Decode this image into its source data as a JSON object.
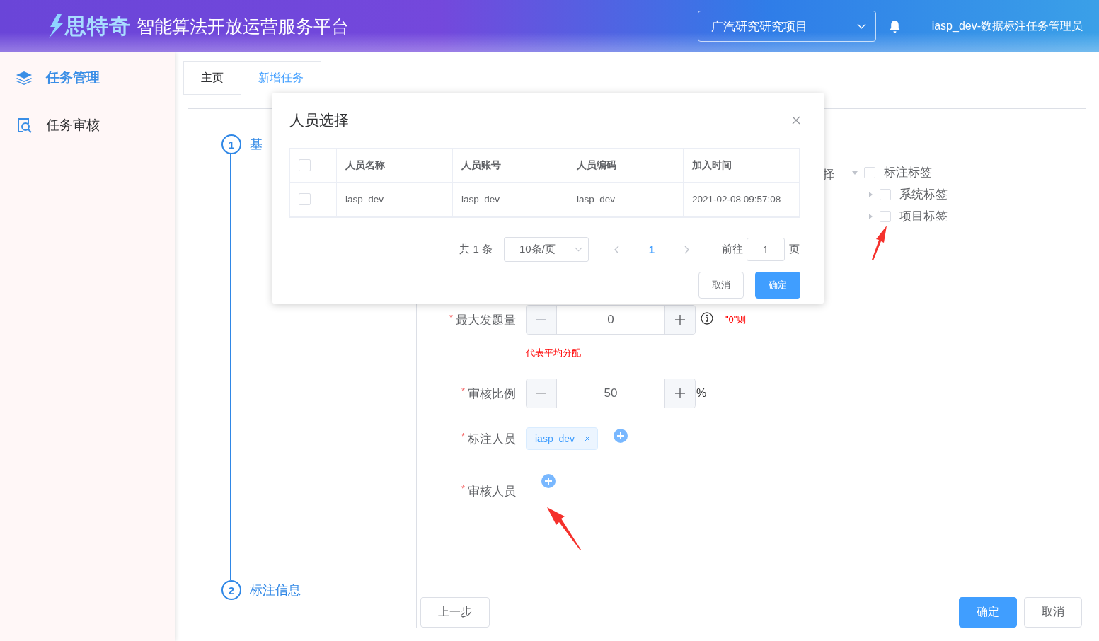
{
  "header": {
    "logo_text": "思特奇",
    "title": "智能算法开放运营服务平台",
    "project_select": {
      "value": "广汽研究研究项目"
    },
    "user": "iasp_dev-数据标注任务管理员"
  },
  "sidebar": {
    "items": [
      {
        "label": "任务管理",
        "selected": true
      },
      {
        "label": "任务审核",
        "selected": false
      }
    ]
  },
  "tabs": [
    {
      "label": "主页",
      "selected": false
    },
    {
      "label": "新增任务",
      "selected": true
    }
  ],
  "steps": [
    {
      "number": "1",
      "label": "基"
    },
    {
      "number": "2",
      "label": "标注信息"
    }
  ],
  "form": {
    "tree_label": "择",
    "tree": [
      {
        "label": "标注标签",
        "expanded": true,
        "checked": false,
        "children": [
          {
            "label": "系统标签",
            "expanded": false,
            "checked": false
          },
          {
            "label": "项目标签",
            "expanded": false,
            "checked": false
          }
        ]
      }
    ],
    "fields": [
      {
        "kind": "number",
        "label": "最大发题量",
        "required_mark": "*",
        "value": "0",
        "decrease_disabled": true,
        "info": true,
        "note": "\"0\"则",
        "hint": "代表平均分配"
      },
      {
        "kind": "number",
        "label": "审核比例",
        "required_mark": "*",
        "value": "50",
        "decrease_disabled": false,
        "suffix": "%"
      },
      {
        "kind": "people",
        "label": "标注人员",
        "required_mark": "*",
        "tags": [
          "iasp_dev"
        ]
      },
      {
        "kind": "people",
        "label": "审核人员",
        "required_mark": "*"
      }
    ],
    "buttons": {
      "prev": "上一步",
      "confirm": "确定",
      "cancel": "取消"
    }
  },
  "dialog": {
    "title": "人员选择",
    "header_checked": false,
    "columns": [
      "人员名称",
      "人员账号",
      "人员编码",
      "加入时间"
    ],
    "rows": [
      {
        "checked": false,
        "cells": [
          "iasp_dev",
          "iasp_dev",
          "iasp_dev",
          "2021-02-08 09:57:08"
        ]
      }
    ],
    "pagination": {
      "total": "共 1 条",
      "page_size": "10条/页",
      "pages": [
        {
          "label": "1",
          "selected": true
        }
      ],
      "goto_label": "前往",
      "goto_value": "1",
      "page_suffix": "页"
    },
    "buttons": {
      "cancel": "取消",
      "confirm": "确定"
    }
  }
}
